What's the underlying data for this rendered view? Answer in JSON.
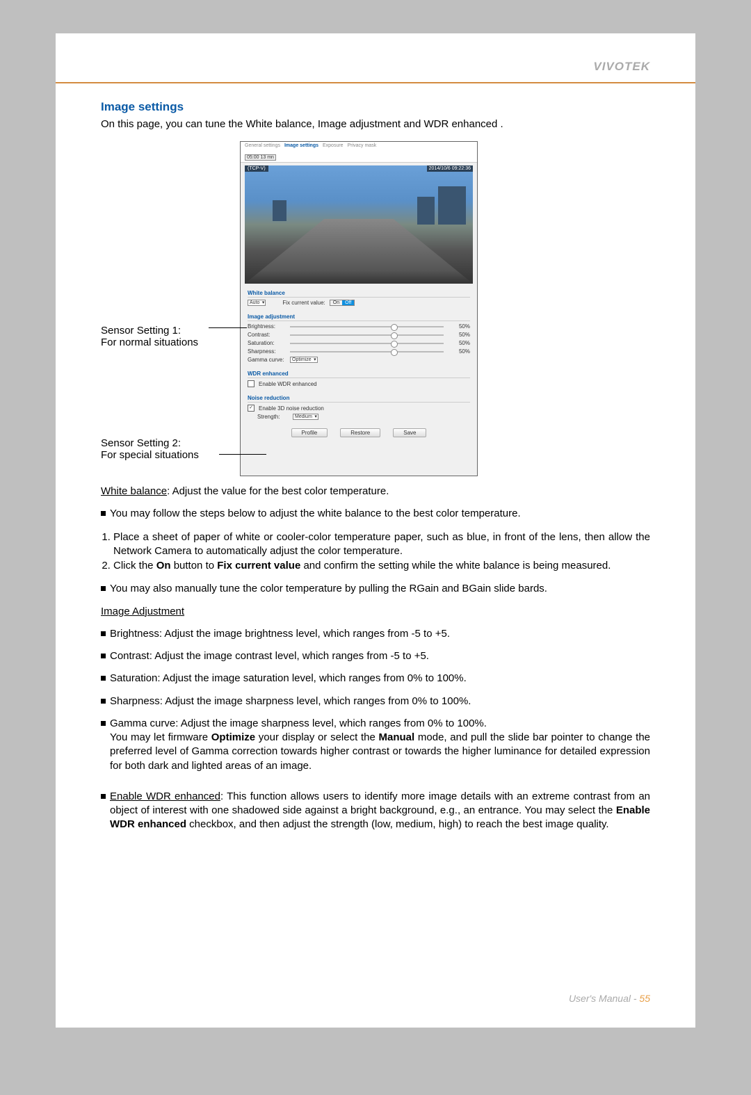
{
  "brand": "VIVOTEK",
  "heading": "Image settings",
  "intro": "On this page, you can tune the White balance, Image adjustment and WDR enhanced .",
  "panel": {
    "tabs": [
      "General settings",
      "Image settings",
      "Exposure",
      "Privacy mask"
    ],
    "reset": "05:00 13 mn",
    "tcp": "(TCP-V)",
    "timestamp": "2014/10/6 09:22:36",
    "sections": {
      "wb": {
        "title": "White balance",
        "mode_label": "Auto",
        "fix_label": "Fix current value:",
        "on": "On",
        "off": "Off"
      },
      "img": {
        "title": "Image adjustment",
        "rows": [
          {
            "label": "Brightness:",
            "value": "50%"
          },
          {
            "label": "Contrast:",
            "value": "50%"
          },
          {
            "label": "Saturation:",
            "value": "50%"
          },
          {
            "label": "Sharpness:",
            "value": "50%"
          }
        ],
        "gamma": {
          "label": "Gamma curve:",
          "value": "Optimize"
        }
      },
      "wdr": {
        "title": "WDR enhanced",
        "enable": "Enable WDR enhanced"
      },
      "nr": {
        "title": "Noise reduction",
        "enable": "Enable 3D noise reduction",
        "strength": {
          "label": "Strength:",
          "value": "Medium"
        }
      }
    },
    "buttons": {
      "profile": "Profile",
      "restore": "Restore",
      "save": "Save"
    }
  },
  "callouts": {
    "s1a": "Sensor Setting 1:",
    "s1b": "For normal situations",
    "s2a": "Sensor Setting 2:",
    "s2b": "For special situations"
  },
  "body": {
    "wb_head": "White balance",
    "wb_tail": ": Adjust the value for the best color temperature.",
    "wb_follow": "You may follow the steps below to adjust the white balance to the best color temperature.",
    "step1": "Place a sheet of paper of white or cooler-color temperature paper, such as blue, in front of the lens, then allow the Network Camera to automatically adjust the color temperature.",
    "step2a": "Click the ",
    "step2b": "On",
    "step2c": " button to ",
    "step2d": "Fix current value",
    "step2e": " and confirm the setting while the white balance is being measured.",
    "manual": "You may also manually tune the color temperature by pulling the RGain and BGain slide bards.",
    "img_head": "Image Adjustment",
    "li_bright": "Brightness: Adjust the image brightness level, which ranges from -5 to +5.",
    "li_contrast": "Contrast: Adjust the image contrast level, which ranges from -5 to +5.",
    "li_sat": "Saturation: Adjust the image saturation level, which ranges from 0% to 100%.",
    "li_sharp": "Sharpness: Adjust the image sharpness level, which ranges from 0% to 100%.",
    "li_gamma_a": "Gamma curve: Adjust the image sharpness level, which ranges from 0% to 100%.",
    "li_gamma_b1": "You may let firmware ",
    "li_gamma_b2": "Optimize",
    "li_gamma_b3": " your display or select the ",
    "li_gamma_b4": "Manual",
    "li_gamma_b5": " mode, and pull the slide bar pointer to change the preferred level of Gamma correction towards higher contrast or towards the higher luminance for detailed expression for both dark and lighted areas of an image.",
    "li_wdr_a": "Enable WDR enhanced",
    "li_wdr_b": ": This function allows users to identify more image details with an extreme contrast from an object of interest with one shadowed side against a bright background, e.g., an entrance. You may select the ",
    "li_wdr_c": "Enable WDR enhanced",
    "li_wdr_d": " checkbox, and then adjust the strength (low, medium, high) to reach the best image quality."
  },
  "footer": {
    "label": "User's Manual - ",
    "page": "55"
  }
}
